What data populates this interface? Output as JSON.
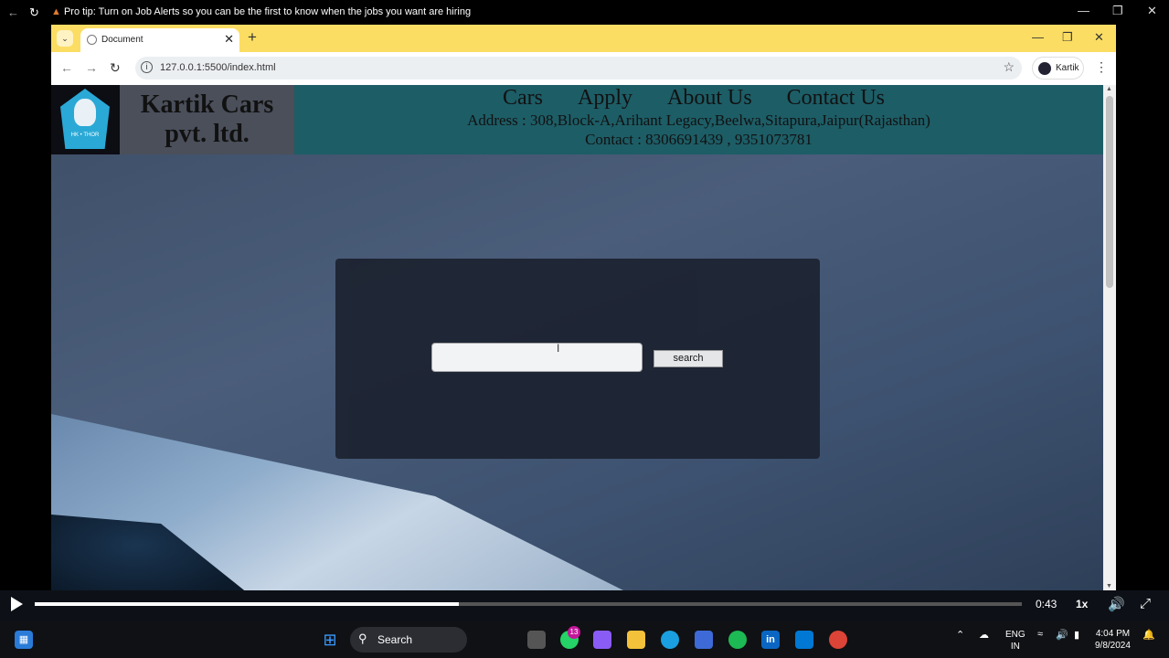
{
  "outer": {
    "pro_tip": "Pro tip: Turn on Job Alerts so you can be the first to know when the jobs you want are hiring"
  },
  "browser": {
    "tab_title": "Document",
    "url": "127.0.0.1:5500/index.html",
    "profile_name": "Kartik"
  },
  "site": {
    "logo_text": "HK • THOR",
    "brand_line1": "Kartik Cars",
    "brand_line2": "pvt. ltd.",
    "nav": [
      "Cars",
      "Apply",
      "About Us",
      "Contact Us"
    ],
    "address": "Address : 308,Block-A,Arihant Legacy,Beelwa,Sitapura,Jaipur(Rajasthan)",
    "contact": "Contact : 8306691439 , 9351073781",
    "search": {
      "value": "",
      "placeholder": "",
      "button_label": "search"
    }
  },
  "player": {
    "time": "0:43",
    "speed": "1x",
    "progress_fraction": 0.43
  },
  "taskbar": {
    "search_label": "Search",
    "whatsapp_badge": "13",
    "lang_line1": "ENG",
    "lang_line2": "IN",
    "time": "4:04 PM",
    "date": "9/8/2024"
  },
  "colors": {
    "tabstrip": "#fcdd63",
    "site_header": "#1d5d66",
    "search_panel": "#1c2230"
  }
}
